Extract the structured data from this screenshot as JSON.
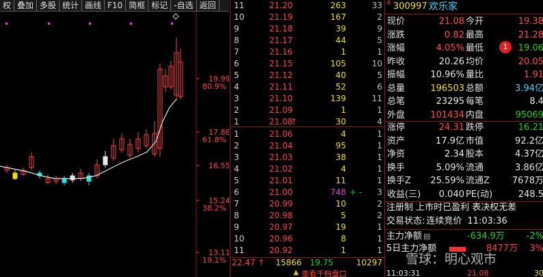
{
  "toolbar": [
    "权",
    "叠加",
    "多股",
    "统计",
    "画线",
    "F10",
    "简框",
    "标记",
    "-自选",
    "返回"
  ],
  "chart": {
    "axis_labels": [
      {
        "price": "19.99",
        "pct": "80.9%"
      },
      {
        "price": "17.86",
        "pct": "61.8%"
      },
      {
        "price": "16.55",
        "pct": ""
      },
      {
        "price": "15.24",
        "pct": "38.2%"
      },
      {
        "price": "13.11",
        "pct": "19.1%"
      }
    ]
  },
  "book": {
    "asks": [
      {
        "level": "11",
        "price": "21.20",
        "vol": "263",
        "seq": "33"
      },
      {
        "level": "10",
        "price": "21.19",
        "vol": "167",
        "seq": "2"
      },
      {
        "level": "9",
        "price": "21.18",
        "vol": "39",
        "seq": "9"
      },
      {
        "level": "8",
        "price": "21.17",
        "vol": "44",
        "seq": "5"
      },
      {
        "level": "7",
        "price": "21.16",
        "vol": "1",
        "seq": "1"
      },
      {
        "level": "6",
        "price": "21.15",
        "vol": "105",
        "seq": "10"
      },
      {
        "level": "5",
        "price": "21.12",
        "vol": "40",
        "seq": "5"
      },
      {
        "level": "4",
        "price": "21.11",
        "vol": "52",
        "seq": "6"
      },
      {
        "level": "3",
        "price": "21.10",
        "vol": "139",
        "seq": "11"
      },
      {
        "level": "2",
        "price": "21.09",
        "vol": "1",
        "seq": "1"
      },
      {
        "level": "1",
        "price": "21.08",
        "vol": "30",
        "seq": "4",
        "arrow": "↑"
      }
    ],
    "bids": [
      {
        "level": "1",
        "price": "21.06",
        "vol": "4",
        "seq": "1"
      },
      {
        "level": "2",
        "price": "21.04",
        "vol": "95",
        "seq": "1"
      },
      {
        "level": "3",
        "price": "21.03",
        "vol": "38",
        "seq": "1"
      },
      {
        "level": "4",
        "price": "21.02",
        "vol": "4",
        "seq": "1"
      },
      {
        "level": "5",
        "price": "21.01",
        "vol": "11",
        "seq": "1"
      },
      {
        "level": "6",
        "price": "21.00",
        "vol": "748",
        "seq": "3",
        "extra": "+ -"
      },
      {
        "level": "7",
        "price": "20.99",
        "vol": "10",
        "seq": "2"
      },
      {
        "level": "8",
        "price": "20.98",
        "vol": "5",
        "seq": "2"
      },
      {
        "level": "9",
        "price": "20.97",
        "vol": "19",
        "seq": "1"
      },
      {
        "level": "10",
        "price": "20.96",
        "vol": "8",
        "seq": "1"
      },
      {
        "level": "11",
        "price": "20.92",
        "vol": "1",
        "seq": "1"
      }
    ],
    "footer": {
      "high": "22.47",
      "high_arrow": "↑",
      "vol1": "15866",
      "low": "19.75",
      "vol2": "10297"
    },
    "bottom_link": "查看千档盘口"
  },
  "quote": {
    "code": "300997",
    "name": "欢乐家",
    "badge": "1",
    "rows": [
      {
        "l1": "现价",
        "v1": "21.08",
        "c1": "red",
        "l2": "今开",
        "v2": "19.38",
        "c2": "red"
      },
      {
        "l1": "涨跌",
        "v1": "0.82",
        "c1": "red",
        "l2": "最高",
        "v2": "21.28",
        "c2": "red"
      },
      {
        "l1": "涨幅",
        "v1": "4.05%",
        "c1": "red",
        "l2": "最低",
        "v2": "19.06",
        "c2": "grn"
      },
      {
        "l1": "昨收",
        "v1": "20.26",
        "c1": "wht",
        "l2": "均价",
        "v2": "20.05",
        "c2": "red"
      },
      {
        "l1": "振幅",
        "v1": "10.96%",
        "c1": "wht",
        "l2": "量比",
        "v2": "1.91",
        "c2": "red"
      },
      {
        "l1": "总量",
        "v1": "196503",
        "c1": "yel",
        "l2": "总额",
        "v2": "3.94亿",
        "c2": "cyn"
      },
      {
        "l1": "总笔",
        "v1": "23295",
        "c1": "wht",
        "l2": "每笔",
        "v2": "8.4",
        "c2": "wht"
      },
      {
        "l1": "外盘",
        "v1": "101434",
        "c1": "red",
        "l2": "内盘",
        "v2": "95069",
        "c2": "grn"
      }
    ],
    "rows2": [
      {
        "l1": "涨停",
        "v1": "24.31",
        "c1": "red",
        "l2": "跌停",
        "v2": "16.21",
        "c2": "grn"
      },
      {
        "l1": "资产",
        "v1": "17.9亿",
        "c1": "wht",
        "l2": "市值",
        "v2": "92.2亿",
        "c2": "wht"
      },
      {
        "l1": "净资",
        "v1": "2.34",
        "c1": "wht",
        "l2": "股本",
        "v2": "4.37亿",
        "c2": "wht"
      },
      {
        "l1": "换手",
        "v1": "5.09%",
        "c1": "wht",
        "l2": "流通",
        "v2": "3.86亿",
        "c2": "wht"
      },
      {
        "l1": "换手Z",
        "v1": "25.59%",
        "c1": "wht",
        "l2": "流通Z",
        "v2": "7678万",
        "c2": "wht"
      },
      {
        "l1": "收益(三)",
        "v1": "0.040",
        "c1": "wht",
        "l2": "PE(动)",
        "v2": "248.5",
        "c2": "wht"
      }
    ],
    "notice": "注册制 上市时已盈利 表决权无差",
    "status_label": "交易状态:",
    "status_value": "连续竞价",
    "status_time": "11:03:36",
    "main_net_label": "主力净额",
    "main_net_value": "-634.9万",
    "main_net_pct": "-2%",
    "five_day_label": "5日主力净额",
    "five_day_value": "8477万",
    "five_day_pct": "3%",
    "bottom_time": "11:03:31",
    "bottom_vals": [
      "21.08",
      "30"
    ],
    "watermark": "雪球：明心观市"
  }
}
